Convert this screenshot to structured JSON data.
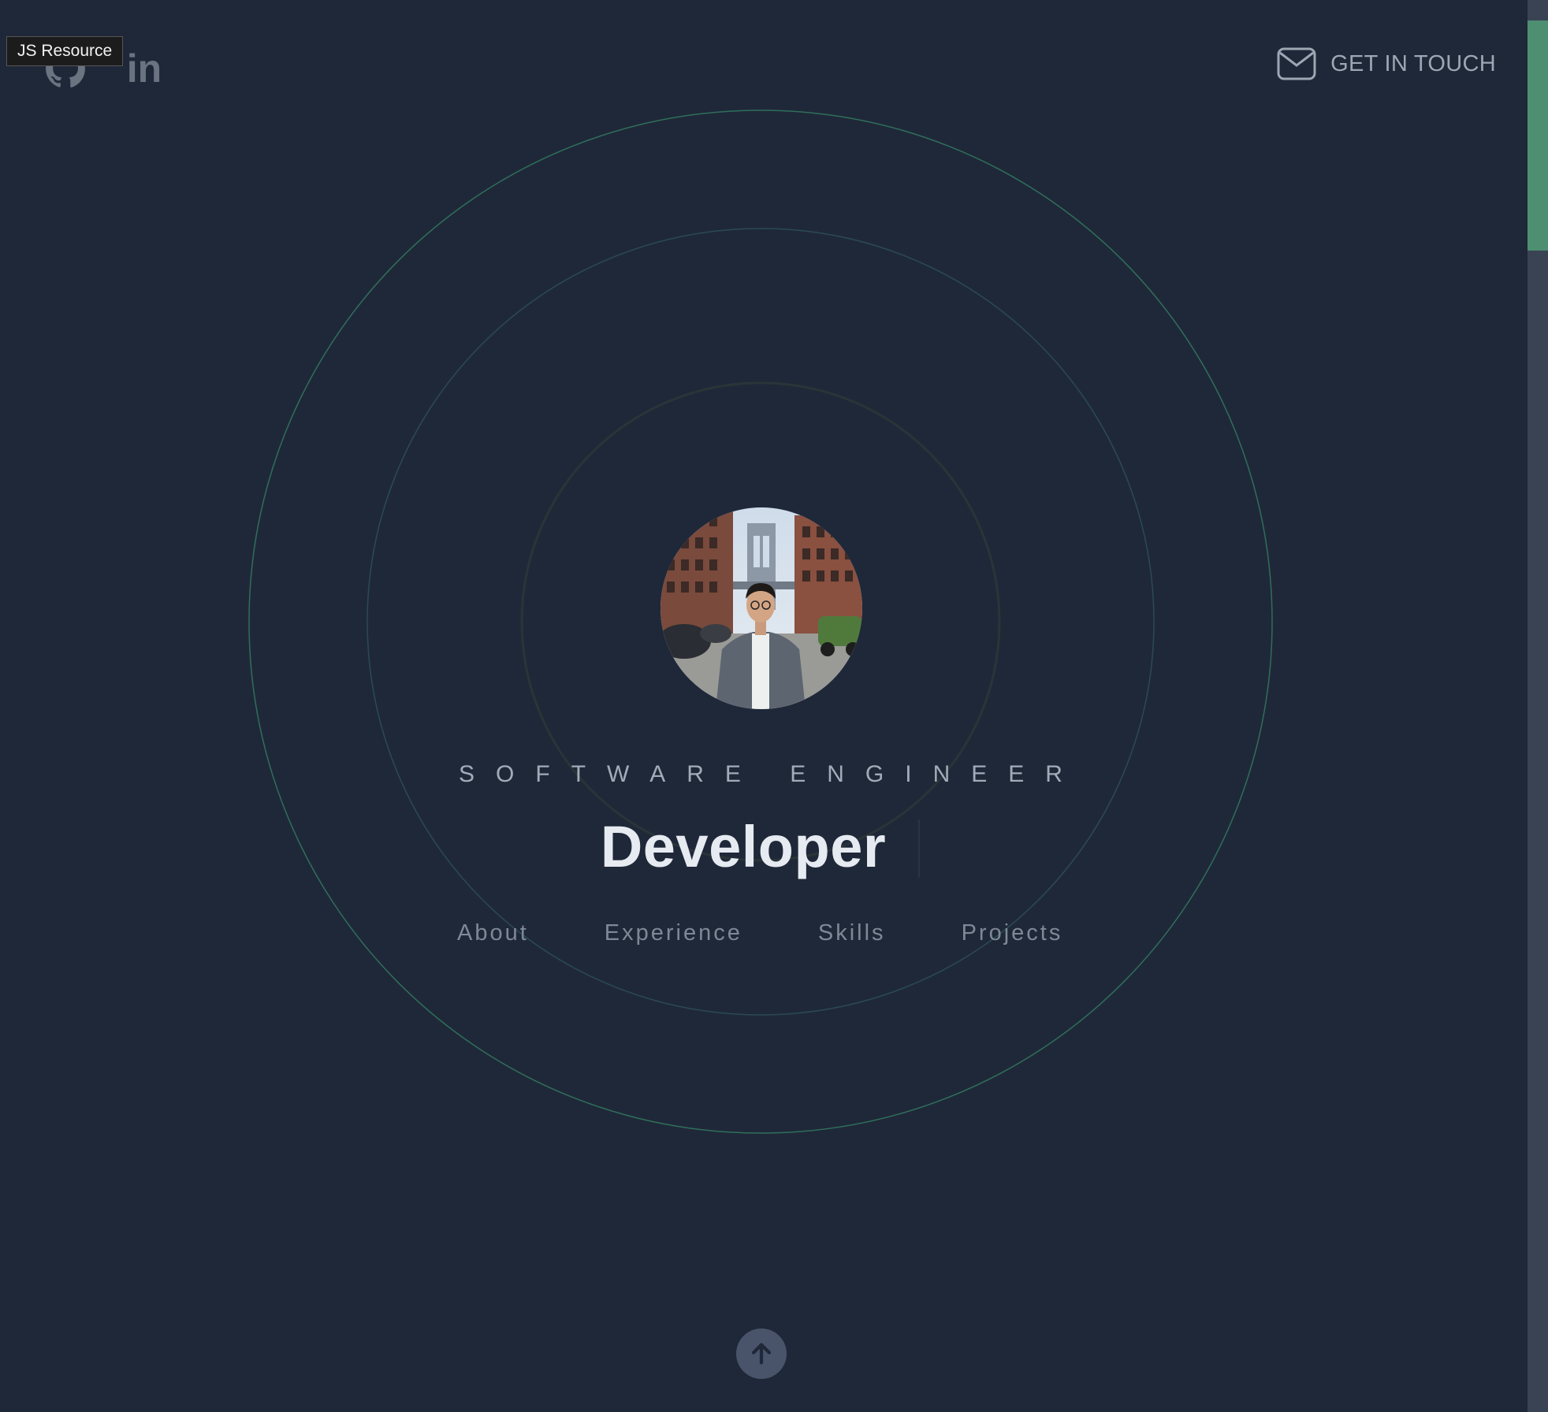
{
  "tooltip": {
    "text": "JS Resource"
  },
  "social": {
    "github_icon": "github-icon",
    "linkedin_label": "in"
  },
  "contact": {
    "label": "GET IN TOUCH",
    "icon": "mail-icon"
  },
  "hero": {
    "role": "SOFTWARE ENGINEER",
    "headline": "Developer",
    "avatar_alt": "profile-photo"
  },
  "nav": {
    "items": [
      {
        "label": "About"
      },
      {
        "label": "Experience"
      },
      {
        "label": "Skills"
      },
      {
        "label": "Projects"
      }
    ]
  },
  "scroll_up": {
    "icon": "arrow-up-icon"
  },
  "colors": {
    "background": "#1f2839",
    "accent": "#4e8f72",
    "headline": "#e6eaf1",
    "muted": "#7f8896"
  }
}
